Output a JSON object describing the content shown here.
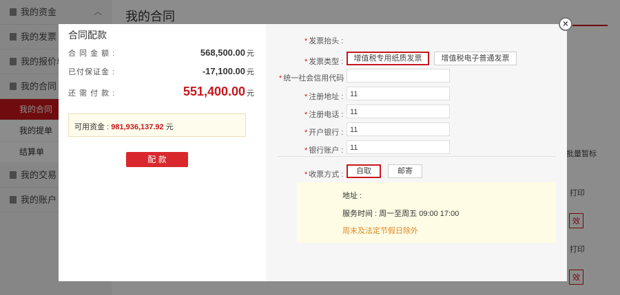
{
  "sidebar": {
    "items": [
      {
        "label": "我的资金"
      },
      {
        "label": "我的发票"
      },
      {
        "label": "我的报价单"
      },
      {
        "label": "我的合同"
      },
      {
        "label": "我的交易"
      },
      {
        "label": "我的账户"
      }
    ],
    "subitems": [
      {
        "label": "我的合同"
      },
      {
        "label": "我的提单"
      },
      {
        "label": "结算单"
      }
    ]
  },
  "main": {
    "title": "我的合同",
    "bg_header": "批量暂标",
    "bg_print1": "打印",
    "bg_print2": "打印",
    "bg_red1": "效",
    "bg_red2": "效"
  },
  "modal": {
    "title": "合同配款",
    "contract_amount_label": "合 同 金 额 :",
    "contract_amount": "568,500.00",
    "paid_deposit_label": "已付保证金 :",
    "paid_deposit": "-17,100.00",
    "remaining_label": "还 需 付 款 :",
    "remaining": "551,400.00",
    "unit": "元",
    "available_label": "可用资金 :",
    "available_value": "981,936,137.92",
    "pay_button": "配 款",
    "close": "×",
    "invoice": {
      "title_label": "发票抬头 :",
      "type_label": "发票类型 :",
      "type_options": [
        "增值税专用纸质发票",
        "增值税电子普通发票"
      ],
      "tax_id_label": "统一社会信用代码 :",
      "tax_id_value": "",
      "address_label": "注册地址 :",
      "address_value": "11",
      "phone_label": "注册电话 :",
      "phone_value": "11",
      "bank_label": "开户银行 :",
      "bank_value": "11",
      "account_label": "银行账户 :",
      "account_value": "11",
      "receive_label": "收票方式 :",
      "receive_options": [
        "自取",
        "邮寄"
      ],
      "pickup_address_label": "地址 :",
      "hours": "服务时间 : 周一至周五 09:00 17:00",
      "holiday_note": "周末及法定节假日除外"
    }
  }
}
